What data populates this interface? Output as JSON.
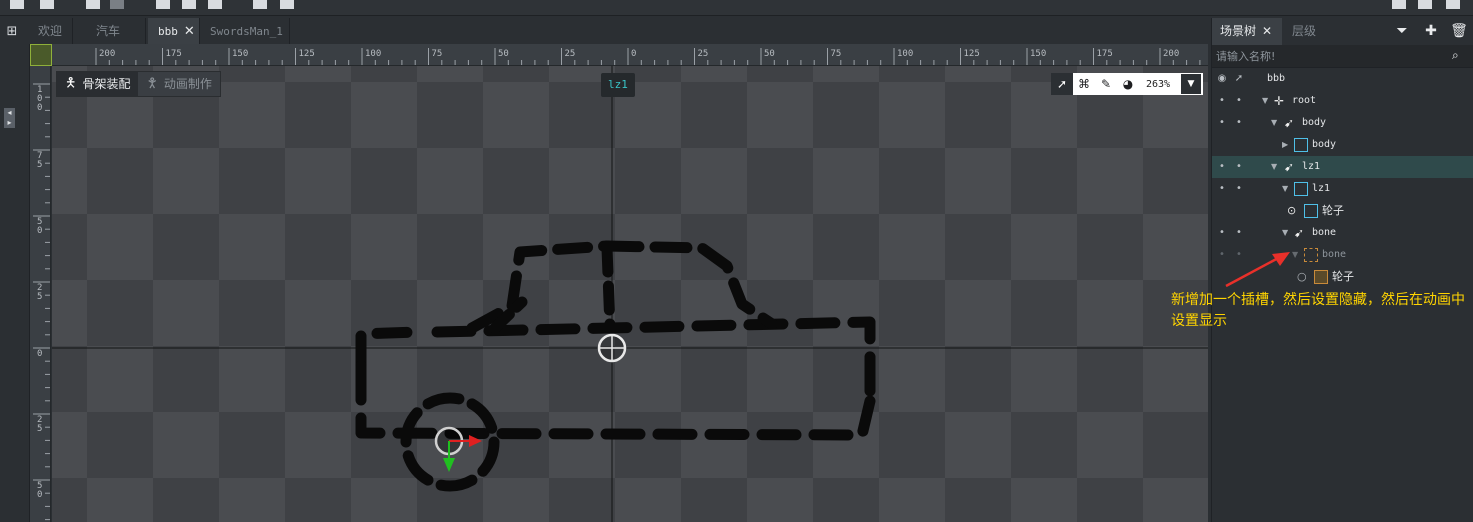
{
  "tabs": [
    {
      "label": "欢迎",
      "active": false
    },
    {
      "label": "汽车",
      "active": false
    },
    {
      "label": "bbb",
      "active": true
    },
    {
      "label": "SwordsMan_1",
      "active": false
    }
  ],
  "ruler": {
    "h_ticks": [
      "200",
      "175",
      "150",
      "125",
      "100",
      "75",
      "50",
      "25",
      "0",
      "25",
      "50",
      "75",
      "100",
      "125",
      "150",
      "175",
      "200"
    ],
    "v_ticks": [
      "100",
      "75",
      "50",
      "25",
      "0",
      "25",
      "50"
    ]
  },
  "mode_toggle": {
    "rig_label": "骨架装配",
    "anim_label": "动画制作"
  },
  "selection_tag": "lz1",
  "view_toolbar": {
    "zoom": "263%"
  },
  "panel": {
    "tab_scene_tree": "场景树",
    "tab_layers": "层级",
    "search_placeholder": "请输入名称!",
    "tree": [
      {
        "label": "bbb"
      },
      {
        "label": "root"
      },
      {
        "label": "body"
      },
      {
        "label": "body"
      },
      {
        "label": "lz1"
      },
      {
        "label": "lz1"
      },
      {
        "label": "轮子"
      },
      {
        "label": "bone"
      },
      {
        "label": "bone"
      },
      {
        "label": "轮子"
      }
    ]
  },
  "annotation": "新增加一个插槽，然后设置隐藏，然后在动画中设置显示",
  "colors": {
    "annotation": "#ffd400",
    "tag_text": "#39c5c8",
    "selected_row": "#2f4a4b",
    "arrow": "#e8302a"
  }
}
